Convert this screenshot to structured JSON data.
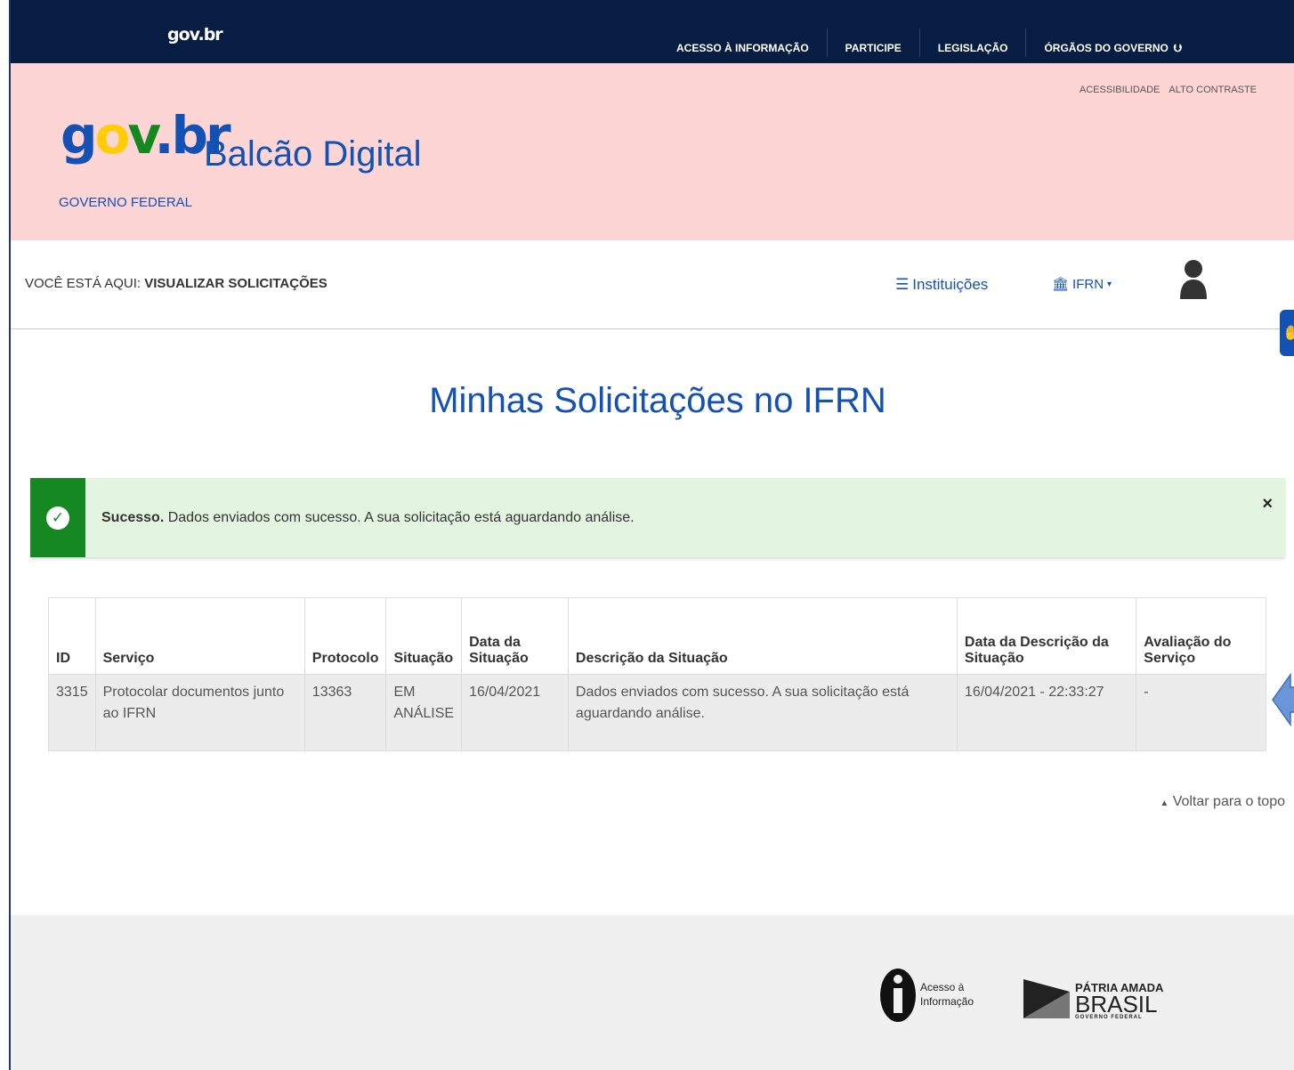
{
  "topbar": {
    "brand": "gov.br",
    "nav": [
      "ACESSO À INFORMAÇÃO",
      "PARTICIPE",
      "LEGISLAÇÃO",
      "ÓRGÃOS DO GOVERNO"
    ]
  },
  "header": {
    "accessibility": "ACESSIBILIDADE",
    "high_contrast": "ALTO CONTRASTE",
    "logo": {
      "g": "g",
      "o": "o",
      "v": "v",
      "dot": ".",
      "br": "br"
    },
    "site_title": "Balcão Digital",
    "gov_federal": "GOVERNO FEDERAL"
  },
  "breadcrumb": {
    "prefix": "VOCÊ ESTÁ AQUI: ",
    "current": "VISUALIZAR SOLICITAÇÕES"
  },
  "nav": {
    "institutions": "Instituições",
    "institution_selected": "IFRN"
  },
  "page_title": "Minhas Solicitações no IFRN",
  "alert": {
    "title": "Sucesso.",
    "message": " Dados enviados com sucesso. A sua solicitação está aguardando análise.",
    "close": "×"
  },
  "table": {
    "headers": {
      "id": "ID",
      "service": "Serviço",
      "protocol": "Protocolo",
      "status": "Situação",
      "status_date": "Data da Situação",
      "status_desc": "Descrição da Situação",
      "desc_date": "Data da Descrição da Situação",
      "rating": "Avaliação do Serviço"
    },
    "rows": [
      {
        "id": "3315",
        "service": "Protocolar documentos junto ao IFRN",
        "protocol": "13363",
        "status": "EM ANÁLISE",
        "status_date": "16/04/2021",
        "status_desc": "Dados enviados com sucesso. A sua solicitação está aguardando análise.",
        "desc_date": "16/04/2021 - 22:33:27",
        "rating": "-"
      }
    ]
  },
  "back_to_top": "Voltar para o topo",
  "footer": {
    "access_info_line1": "Acesso à",
    "access_info_line2": "Informação",
    "patria_amada": "PÁTRIA AMADA",
    "brasil": "BRASIL",
    "gov_federal": "GOVERNO FEDERAL"
  },
  "colors": {
    "topbar": "#071d41",
    "header": "#fdd5d5",
    "primary_blue": "#1351b4",
    "success_green": "#168821",
    "alert_bg": "#e3f5e1"
  }
}
